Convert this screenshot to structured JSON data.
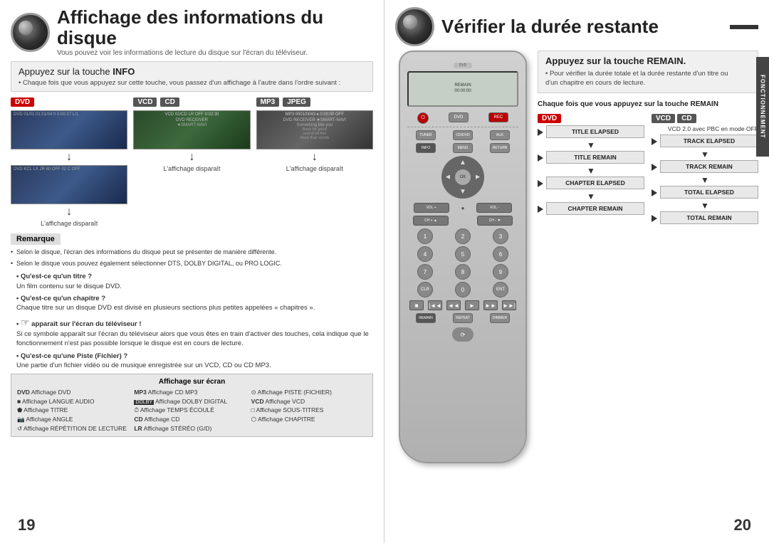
{
  "left_page": {
    "number": "19",
    "header": {
      "title": "Affichage des informations du disque",
      "subtitle": "Vous pouvez voir les informations de lecture du disque sur l'écran du téléviseur."
    },
    "info_box": {
      "prefix": "Appuyez sur la touche ",
      "key": "INFO",
      "bullet": "• Chaque fois que vous appuyez sur cette touche, vous passez d'un affichage à l'autre dans l'ordre suivant :"
    },
    "columns": [
      {
        "badges": [
          "DVD"
        ],
        "caption": "L'affichage disparaît"
      },
      {
        "badges": [
          "VCD",
          "CD"
        ],
        "caption": "L'affichage disparaît"
      },
      {
        "badges": [
          "MP3",
          "JPEG"
        ],
        "caption": "L'affichage disparaît"
      }
    ],
    "remarque": {
      "title": "Remarque",
      "items": [
        "Selon le disque, l'écran des informations du disque peut se présenter de manière différente.",
        "Selon le disque vous pouvez également sélectionner DTS, DOLBY DIGITAL, ou PRO LOGIC."
      ]
    },
    "questions": [
      {
        "title": "Qu'est-ce qu'un titre ?",
        "text": "Un film contenu sur le disque DVD."
      },
      {
        "title": "Qu'est-ce qu'un chapitre ?",
        "text": "Chaque titre sur un disque DVD est divisé en plusieurs sections plus petites appelées « chapitres »."
      },
      {
        "title": "apparaît sur l'écran du téléviseur !",
        "text": "Si ce symbole apparaît sur l'écran du téléviseur alors que vous êtes en train d'activer des touches, cela indique que le fonctionnement n'est pas possible lorsque le disque est en cours de lecture."
      },
      {
        "title": "Qu'est-ce qu'une Piste (Fichier) ?",
        "text": "Une partie d'un fichier vidéo ou de musique enregistrée sur un VCD, CD ou CD MP3."
      }
    ],
    "affichage": {
      "title": "Affichage sur écran",
      "items": [
        "DVD Affichage DVD",
        "MP3 Affichage CD MP3",
        "Affichage PISTE (FICHIER)",
        "Affichage LANGUE AUDIO",
        "DOLBY Affichage DOLBY DIGITAL",
        "VCD Affichage VCD",
        "Affichage TITRE",
        "Affichage TEMPS ÉCOULÉ",
        "Affichage SOUS-TITRES",
        "Affichage ANGLE",
        "CD Affichage CD",
        "Affichage CHAPITRE",
        "Affichage RÉPÉTITION DE LECTURE",
        "LR Affichage STÉRÉO (G/D)"
      ]
    }
  },
  "right_page": {
    "number": "20",
    "header": {
      "title": "Vérifier la durée restante"
    },
    "info_box": {
      "prefix": "Appuyez sur la touche ",
      "key": "REMAIN.",
      "text1": "• Pour vérifier la durée totale et la durée restante d'un titre ou",
      "text2": "d'un chapitre en cours de lecture."
    },
    "question_title": "Chaque fois que vous appuyez sur la touche REMAIN",
    "dvd_column": {
      "badge": "DVD",
      "items": [
        "TITLE ELAPSED",
        "TITLE REMAIN",
        "CHAPTER ELAPSED",
        "CHAPTER REMAIN"
      ]
    },
    "vcd_column": {
      "badges": [
        "VCD",
        "CD"
      ],
      "note": "VCD 2.0 avec PBC en mode OFF",
      "items": [
        "TRACK ELAPSED",
        "TRACK REMAIN",
        "TOTAL ELAPSED",
        "TOTAL REMAIN"
      ]
    },
    "vertical_tab": "FONCTIONNEMENT"
  }
}
